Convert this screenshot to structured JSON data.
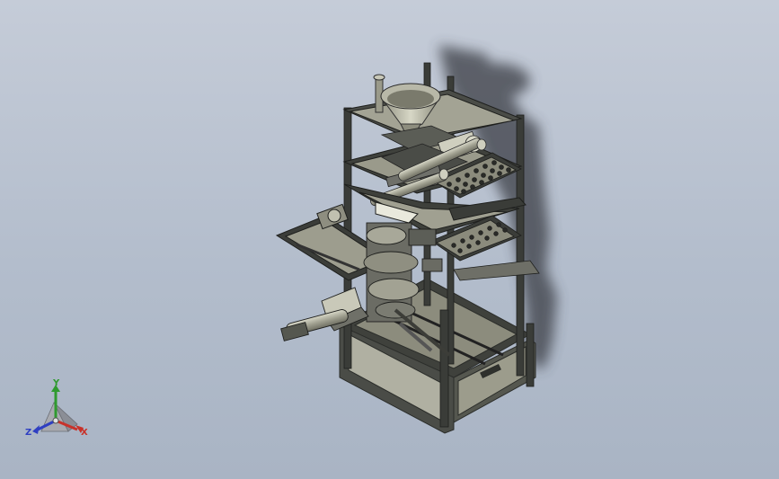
{
  "viewport": {
    "background_top": "#c5ccd8",
    "background_bottom": "#a9b4c4"
  },
  "model": {
    "description_icon": "machine-assembly-icon",
    "frame_color": "#3c3e3a",
    "part_color": "#a7a796",
    "shadow_color": "#3a3d44"
  },
  "triad": {
    "x_label": "X",
    "y_label": "Y",
    "z_label": "Z",
    "x_color": "#c8322a",
    "y_color": "#2f9a2f",
    "z_color": "#2f3fc2"
  }
}
